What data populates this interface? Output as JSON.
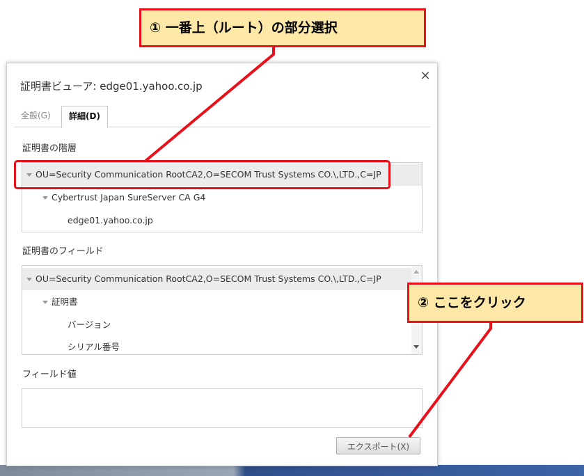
{
  "dialog": {
    "title": "証明書ビューア: edge01.yahoo.co.jp",
    "close_symbol": "×",
    "tabs": [
      {
        "label": "全般(G)",
        "active": false
      },
      {
        "label": "詳細(D)",
        "active": true
      }
    ]
  },
  "hierarchy": {
    "label": "証明書の階層",
    "items": [
      {
        "text": "OU=Security Communication RootCA2,O=SECOM Trust Systems CO.\\,LTD.,C=JP",
        "selected": true
      },
      {
        "text": "Cybertrust Japan SureServer CA G4",
        "selected": false
      },
      {
        "text": "edge01.yahoo.co.jp",
        "selected": false
      }
    ]
  },
  "fields": {
    "label": "証明書のフィールド",
    "items": [
      {
        "text": "OU=Security Communication RootCA2,O=SECOM Trust Systems CO.\\,LTD.,C=JP"
      },
      {
        "text": "証明書"
      },
      {
        "text": "バージョン"
      },
      {
        "text": "シリアル番号"
      }
    ]
  },
  "field_value": {
    "label": "フィールド値",
    "value": ""
  },
  "export_button": {
    "label": "エクスポート(X)"
  },
  "annotations": {
    "callout_1": "① 一番上（ルート）の部分選択",
    "callout_2": "② ここをクリック",
    "accent_color": "#e8101a",
    "callout_fill": "#fde8a8"
  }
}
